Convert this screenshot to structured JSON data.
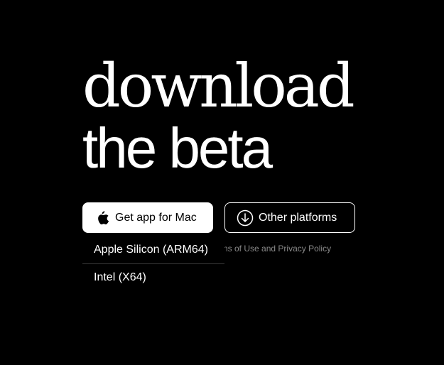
{
  "headline": {
    "line1": "download",
    "line2": "the beta"
  },
  "buttons": {
    "mac_label": "Get app for Mac",
    "mac_icon": "apple-logo-icon",
    "other_label": "Other platforms",
    "other_icon": "download-circle-icon"
  },
  "terms": {
    "prefix": "ns of ",
    "terms_link": "Use",
    "conjunction": " and ",
    "privacy_link": "Privacy Policy"
  },
  "dropdown": {
    "items": [
      {
        "label": "Apple Silicon (ARM64)"
      },
      {
        "label": "Intel (X64)"
      }
    ]
  },
  "colors": {
    "background": "#000000",
    "foreground": "#ffffff",
    "muted": "#8a8a8a"
  }
}
